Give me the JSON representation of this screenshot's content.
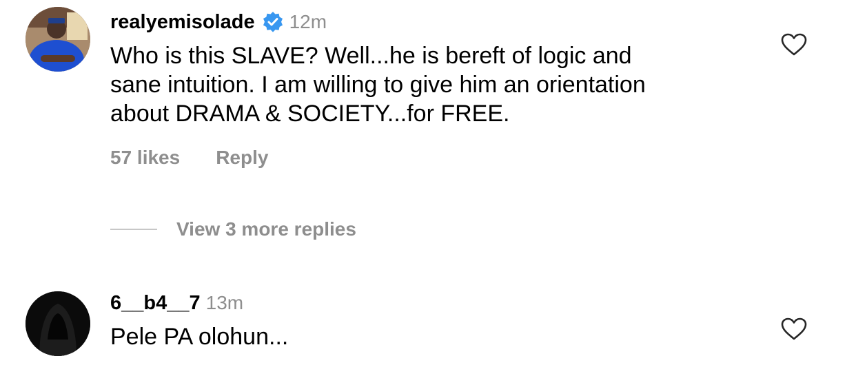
{
  "comments": [
    {
      "username": "realyemisolade",
      "verified": true,
      "time": "12m",
      "text_lines": [
        "Who is this SLAVE? Well...he is bereft of logic and",
        "sane intuition. I am willing to give him an orientation",
        "about DRAMA & SOCIETY...for FREE."
      ],
      "likes": "57 likes",
      "reply_label": "Reply",
      "more_replies": "View 3 more replies",
      "avatar_icon": "profile-photo"
    },
    {
      "username": "6__b4__7",
      "verified": false,
      "time": "13m",
      "text": "Pele PA olohun...",
      "avatar_icon": "hooded-figure-photo"
    }
  ],
  "colors": {
    "secondary_text": "#8e8e8e",
    "verified_blue": "#3897f0",
    "divider": "#c7c7c7"
  }
}
